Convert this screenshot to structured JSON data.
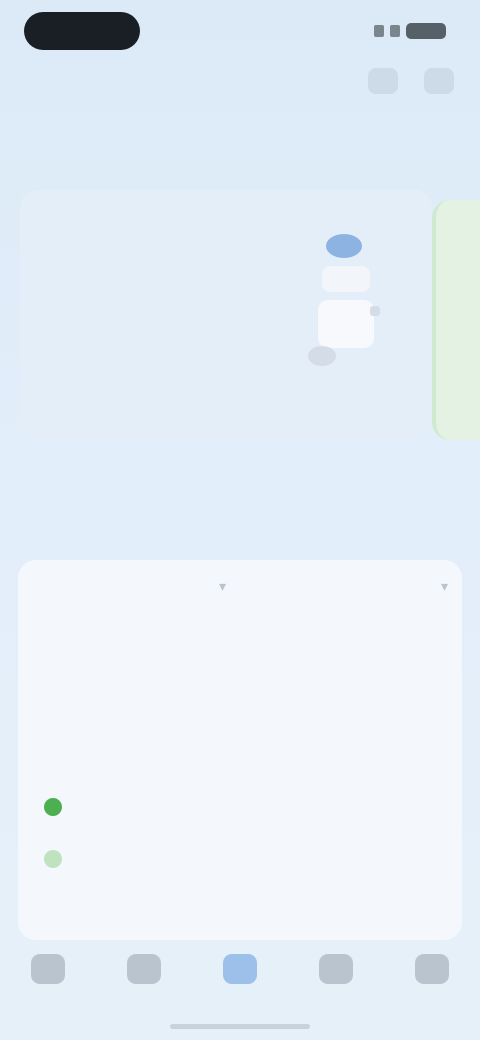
{
  "header": {
    "title": ""
  },
  "sections": {
    "recommend_title": "",
    "data_title": ""
  },
  "promo": {
    "title": "",
    "description": "",
    "link": ""
  },
  "panel": {
    "left_select": "",
    "right_select": "",
    "left_sub": "",
    "right_sub": "",
    "col1": "",
    "col2": "",
    "row_label": "",
    "val1": "",
    "val2": "",
    "legend": [
      {
        "label": "",
        "color": "#4caf50"
      },
      {
        "label": "",
        "color": "#bfe3bf"
      }
    ],
    "footnote": ""
  },
  "nav": {
    "items": [
      {
        "label": "",
        "icon": "home-icon"
      },
      {
        "label": "",
        "icon": "grid-icon"
      },
      {
        "label": "",
        "icon": "center-icon"
      },
      {
        "label": "",
        "icon": "message-icon"
      },
      {
        "label": "",
        "icon": "profile-icon"
      }
    ]
  },
  "colors": {
    "accent": "#4a86d9",
    "green": "#4caf50"
  }
}
